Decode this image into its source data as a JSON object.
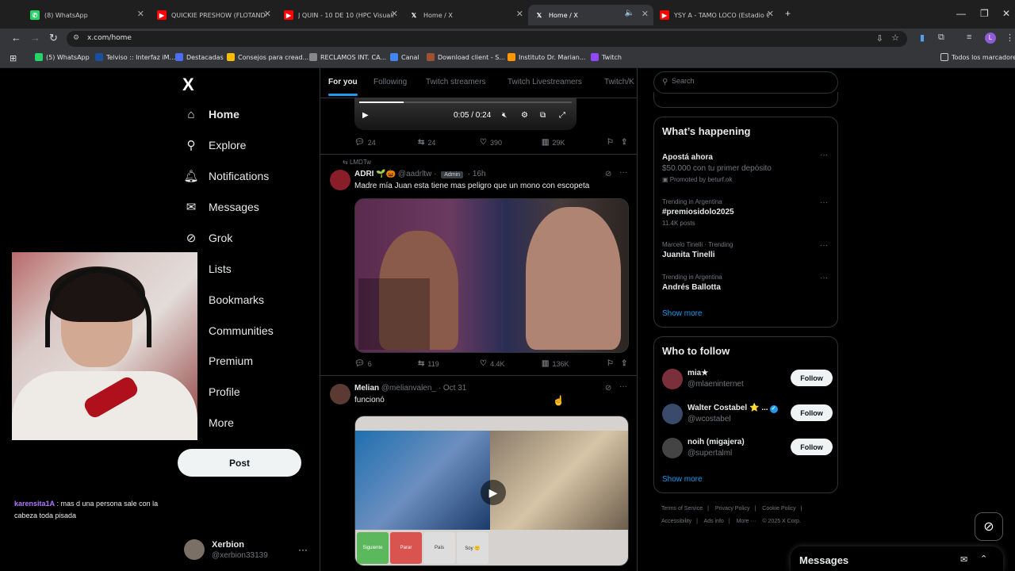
{
  "browser": {
    "tabs": [
      {
        "title": "(8) WhatsApp",
        "fav": "WA",
        "color": "#25d366"
      },
      {
        "title": "QUICKIE PRESHOW (FLOTANDO...",
        "fav": "▶",
        "color": "#ff0000"
      },
      {
        "title": "J QUIN - 10 DE 10 (HPC Visuali...",
        "fav": "▶",
        "color": "#ff0000"
      },
      {
        "title": "Home / X",
        "fav": "X",
        "color": "#000000"
      },
      {
        "title": "Home / X",
        "fav": "X",
        "color": "#000000"
      },
      {
        "title": "YSY A - TAMO LOCO (Estadio O...",
        "fav": "▶",
        "color": "#ff0000"
      }
    ],
    "url": "x.com/home",
    "bookmarks": [
      {
        "label": "(5) WhatsApp",
        "color": "#25d366"
      },
      {
        "label": "Telviso :: Interfaz iM...",
        "color": "#1a4fa0"
      },
      {
        "label": "Destacadas",
        "color": "#4c6ef5"
      },
      {
        "label": "Consejos para cread...",
        "color": "#fbbc04"
      },
      {
        "label": "RECLAMOS INT. CA...",
        "color": "#888888"
      },
      {
        "label": "Canal",
        "color": "#4285f4"
      },
      {
        "label": "Download client - S...",
        "color": "#a0522d"
      },
      {
        "label": "Instituto Dr. Marian...",
        "color": "#ff9800"
      },
      {
        "label": "Twitch",
        "color": "#9146ff"
      }
    ],
    "all_bookmarks": "Todos los marcadores"
  },
  "nav": {
    "logo": "X",
    "items": [
      "Home",
      "Explore",
      "Notifications",
      "Messages",
      "Grok",
      "Lists",
      "Bookmarks",
      "Communities",
      "Premium",
      "Profile",
      "More"
    ],
    "post_label": "Post",
    "profile_name": "Xerbion",
    "profile_handle": "@xerbion33139",
    "more_dots": "···"
  },
  "chat": {
    "user": "karensita1A",
    "message": " : mas d una persona sale con la cabeza toda pisada"
  },
  "feed": {
    "tabs": [
      "For you",
      "Following",
      "Twitch streamers",
      "Twitch Livestreamers",
      "Twitch/K"
    ],
    "video1": {
      "time": "0:05 / 0:24",
      "progress": 0.21,
      "stats": {
        "replies": "24",
        "reposts": "24",
        "likes": "390",
        "views": "29K"
      }
    },
    "post1": {
      "repost_by": "LMDTw",
      "name": "ADRI",
      "emoji": "🌱🎃",
      "handle": "@aadrltw",
      "badge": "Admin",
      "time": "· 16h",
      "text": "Madre mía Juan esta tiene mas peligro que un mono con escopeta",
      "stats": {
        "replies": "6",
        "reposts": "119",
        "likes": "4.4K",
        "views": "136K"
      }
    },
    "post2": {
      "name": "Melian",
      "handle": "@melianvalen_",
      "time": "· Oct 31",
      "text": "funcionó",
      "buttons": [
        "Siguiente",
        "Parar",
        "País",
        "Soy 🙂"
      ]
    }
  },
  "right": {
    "search_placeholder": "Search",
    "whats_happening": "What’s happening",
    "trends": [
      {
        "meta": "",
        "title": "Apostá ahora",
        "sub": "$50.000 con tu primer depósito",
        "promo": "Promoted by beturf.ok"
      },
      {
        "meta": "Trending in Argentina",
        "title": "#premiosidolo2025",
        "sub": "11.4K posts",
        "promo": ""
      },
      {
        "meta": "Marcelo Tinelli · Trending",
        "title": "Juanita Tinelli",
        "sub": "",
        "promo": ""
      },
      {
        "meta": "Trending in Argentina",
        "title": "Andrés Ballotta",
        "sub": "",
        "promo": ""
      }
    ],
    "show_more": "Show more",
    "who_to_follow": "Who to follow",
    "suggestions": [
      {
        "name": "mia★",
        "handle": "@mlaeninternet",
        "color": "#7a2f3a"
      },
      {
        "name": "Walter Costabel ⭐ ...",
        "handle": "@wcostabel",
        "color": "#3b4a6b"
      },
      {
        "name": "noih (migajera)",
        "handle": "@supertalml",
        "color": "#444444"
      }
    ],
    "follow_label": "Follow",
    "footer": [
      "Terms of Service",
      "|",
      "Privacy Policy",
      "|",
      "Cookie Policy",
      "|",
      "Accessibility",
      "|",
      "Ads info",
      "|",
      "More ···",
      "© 2025 X Corp."
    ],
    "messages": "Messages"
  }
}
